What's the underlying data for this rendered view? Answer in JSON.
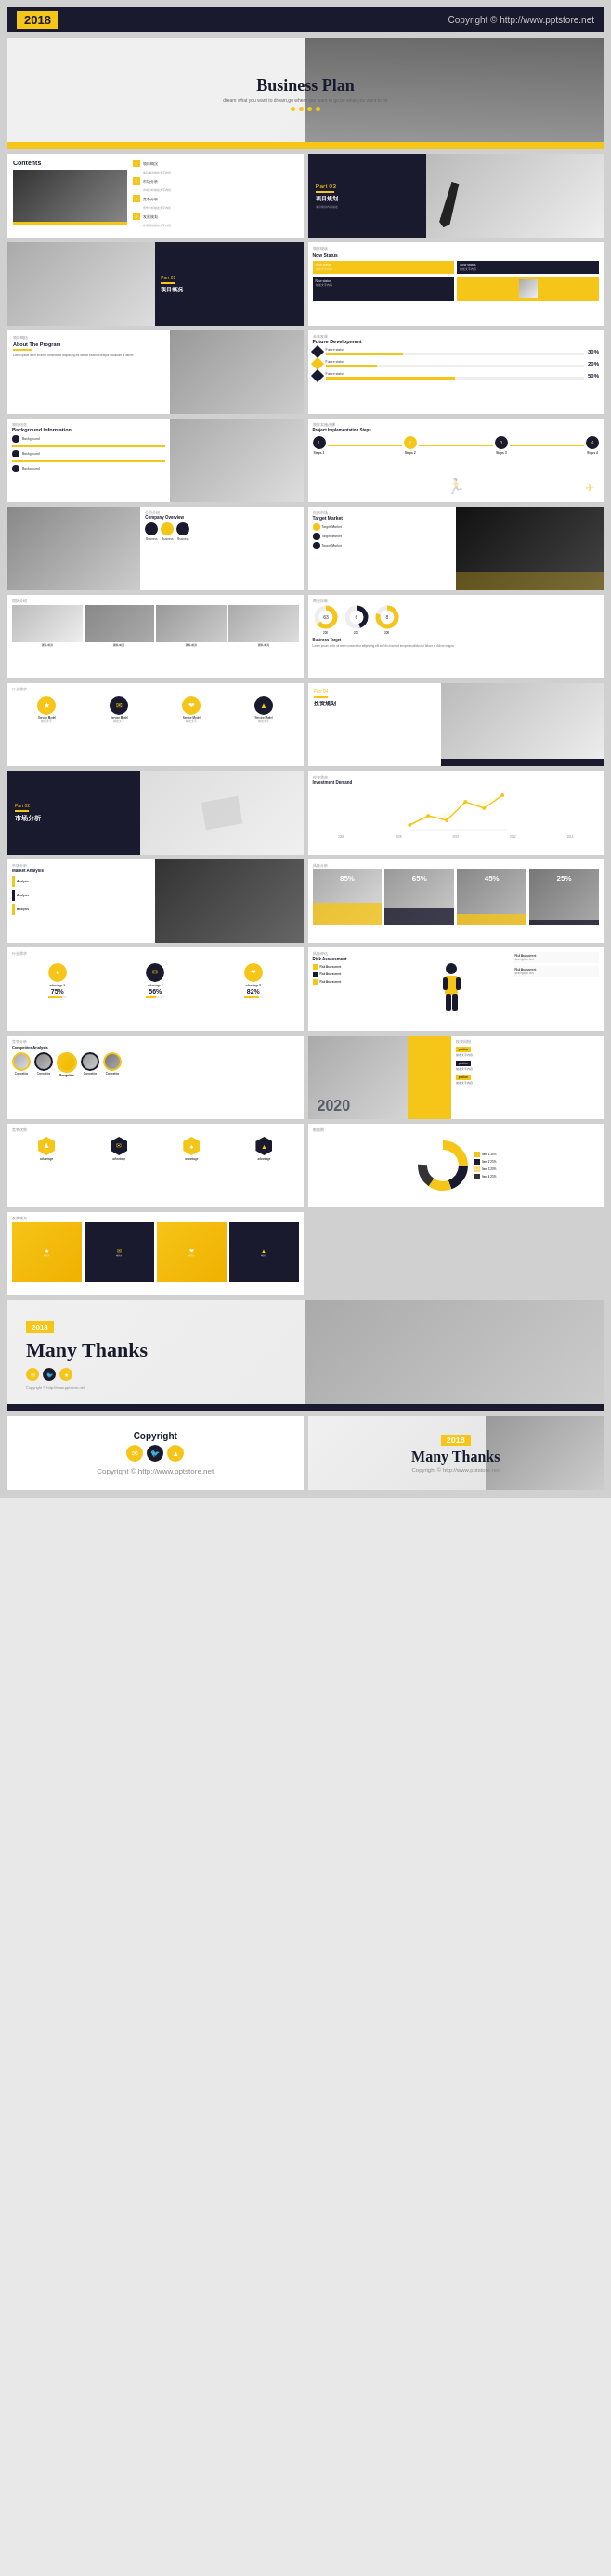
{
  "header": {
    "year": "2018",
    "url": "Copyright © http://www.pptstore.net"
  },
  "slides": [
    {
      "id": "hero",
      "type": "hero",
      "title": "Business Plan",
      "subtitle": "dream what you want to dream,go where you want to go,be what you want to be",
      "dots": 4
    },
    {
      "id": "contents",
      "type": "contents",
      "title": "Contents",
      "items": [
        "1.项目概况",
        "2.市场分析",
        "3.竞争分析",
        "4.发展规划"
      ]
    },
    {
      "id": "part03",
      "type": "part-section",
      "part": "Part 03",
      "subtitle": "项目规划",
      "description": "项目规划描述"
    },
    {
      "id": "part01",
      "type": "part-section",
      "part": "Part 01",
      "subtitle": "项目概况",
      "description": "项目描述"
    },
    {
      "id": "status-grid",
      "type": "info-grid",
      "title": "项目现状",
      "subtitle": "Now Status",
      "items": [
        "Now status",
        "Now status",
        "Now status",
        "Now status"
      ]
    },
    {
      "id": "about-program",
      "type": "info-slide",
      "label": "项目概括",
      "title": "About The Program",
      "text": "Lorem ipsum dolor sit amet consectetur adipiscing elit sed do eiusmod tempor incididunt"
    },
    {
      "id": "future-dev",
      "type": "future-dev",
      "label": "未来发展",
      "title": "Future Development",
      "items": [
        {
          "label": "Future status",
          "pct": "30%"
        },
        {
          "label": "Future status",
          "pct": "20%"
        },
        {
          "label": "Future status",
          "pct": "50%"
        }
      ]
    },
    {
      "id": "background-info",
      "type": "info-rows",
      "label": "项目信息",
      "title": "Background Information",
      "rows": [
        "Background",
        "Background",
        "Background"
      ]
    },
    {
      "id": "project-steps",
      "type": "steps",
      "label": "项目实施步骤",
      "steps": [
        "Steps 1",
        "Steps 2",
        "Steps 3",
        "Steps 4"
      ]
    },
    {
      "id": "company-intro",
      "type": "company-intro",
      "label": "公司介绍",
      "title": "Company Overview",
      "items": [
        "Business",
        "Business",
        "Business"
      ]
    },
    {
      "id": "target-market",
      "type": "target-market",
      "label": "目标市场",
      "items": [
        "Target Market",
        "Target Market",
        "Target Market"
      ]
    },
    {
      "id": "team-intro",
      "type": "team",
      "label": "团队介绍",
      "members": [
        "团队成员",
        "团队成员",
        "团队成员",
        "团队成员"
      ]
    },
    {
      "id": "business-target",
      "type": "business-target",
      "label": "商业目标",
      "title": "Business Target",
      "years": [
        "200",
        "206",
        "208"
      ],
      "values": [
        "30",
        "6",
        "8"
      ]
    },
    {
      "id": "industry-demand",
      "type": "icon-row",
      "label": "行业需求",
      "icons": [
        "★",
        "✉",
        "❤",
        "▲"
      ],
      "labels": [
        "Service Model",
        "Service Model",
        "Service Model",
        "Service Model"
      ]
    },
    {
      "id": "part04",
      "type": "part-section",
      "part": "Part 04",
      "subtitle": "投资规划",
      "description": "投资规划描述"
    },
    {
      "id": "part02",
      "type": "part-section",
      "part": "Part 02",
      "subtitle": "市场分析",
      "description": "市场分析描述"
    },
    {
      "id": "investment-demand",
      "type": "line-chart",
      "label": "投资需求",
      "title": "Investment Demand",
      "points": [
        20,
        35,
        25,
        50,
        40,
        60
      ]
    },
    {
      "id": "market-analysis",
      "type": "analysis-rows",
      "label": "市场分析",
      "rows": [
        "Analysis",
        "Analysis",
        "Analysis"
      ]
    },
    {
      "id": "risk-analysis",
      "type": "percentage-row",
      "label": "风险分析",
      "items": [
        {
          "pct": "85%",
          "label": ""
        },
        {
          "pct": "65%",
          "label": ""
        },
        {
          "pct": "45%",
          "label": ""
        },
        {
          "pct": "25%",
          "label": ""
        }
      ]
    },
    {
      "id": "industry-demand2",
      "type": "bar-chart-industry",
      "label": "行业需求",
      "bars": [
        {
          "label": "advantage 1",
          "pct": 75
        },
        {
          "label": "advantage 2",
          "pct": 56
        },
        {
          "label": "advantage 3",
          "pct": 82
        }
      ]
    },
    {
      "id": "risk-assessment",
      "type": "risk-person",
      "label": "风险评估",
      "title": "Risk Assessment",
      "items": [
        "Risk Assessment",
        "Risk Assessment",
        "Risk Assessment",
        "Risk Assessment"
      ]
    },
    {
      "id": "competitor-analysis",
      "type": "competitor",
      "label": "竞争分析",
      "title": "Competitor Analysis",
      "competitors": [
        "Competitor",
        "Competitor",
        "Competitor",
        "Competitor",
        "Competitor"
      ]
    },
    {
      "id": "investment-return",
      "type": "person-2020",
      "label": "投资回报",
      "year": "2020",
      "positions": [
        "position",
        "position",
        "position"
      ]
    },
    {
      "id": "advantage-compare",
      "type": "hexagon-row",
      "label": "竞争优势",
      "icons": [
        "♟",
        "✉",
        "♠",
        "▲"
      ],
      "labels": [
        "advantage",
        "advantage",
        "advantage",
        "advantage"
      ]
    },
    {
      "id": "donut-infographic",
      "type": "donut-info",
      "label": "数据图",
      "segments": [
        30,
        25,
        20,
        25
      ]
    },
    {
      "id": "dev-planning",
      "type": "dev-planning",
      "label": "发展规划"
    },
    {
      "id": "many-thanks",
      "type": "many-thanks",
      "year": "2018",
      "title": "Many Thanks",
      "url": "Copyright © http://www.pptstore.net"
    }
  ],
  "footer": {
    "copyright": "Copyright",
    "copyright_text": "Copyright © http://www.pptstore.net",
    "many_thanks_year": "2018",
    "many_thanks_text": "Many Thanks",
    "url": "http://www.pptstore.net"
  }
}
